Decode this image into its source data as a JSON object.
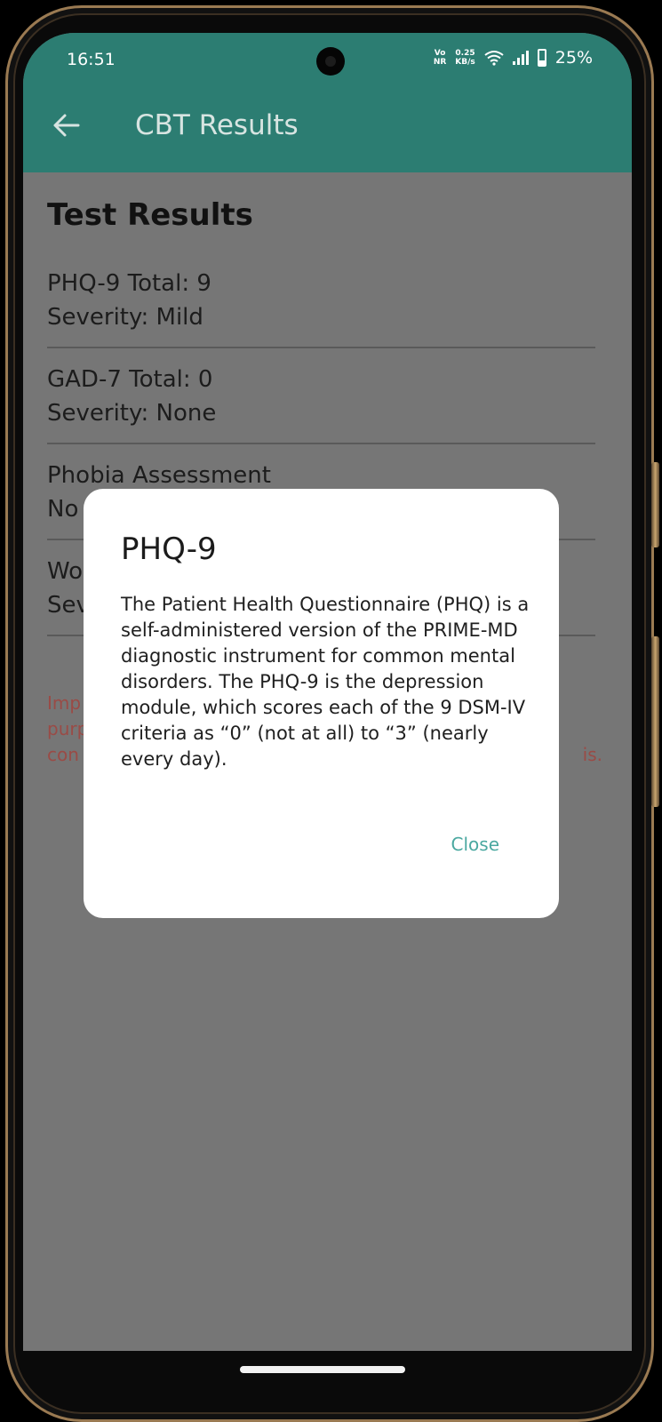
{
  "status_bar": {
    "time": "16:51",
    "network_top": "Vo",
    "network_bottom": "NR",
    "speed_value": "0.25",
    "speed_unit": "KB/s",
    "battery": "25%"
  },
  "app_bar": {
    "title": "CBT Results",
    "back_icon": "arrow-left-icon"
  },
  "results": {
    "heading": "Test Results",
    "items": [
      {
        "line1": "PHQ-9 Total: 9",
        "line2": "Severity: Mild"
      },
      {
        "line1": "GAD-7 Total: 0",
        "line2": "Severity: None"
      },
      {
        "line1": "Phobia Assessment",
        "line2": "No"
      },
      {
        "line1": "Wo",
        "line2": "Sev"
      }
    ],
    "disclaimer_fragments": [
      "Imp",
      "purp",
      "con",
      "is."
    ]
  },
  "dialog": {
    "title": "PHQ-9",
    "body": "The Patient Health Questionnaire (PHQ) is a self-administered version of the PRIME-MD diagnostic instrument for common mental disorders. The PHQ-9 is the depression module, which scores each of the 9 DSM-IV criteria as “0” (not at all) to “3” (nearly every day).",
    "close_label": "Close"
  },
  "colors": {
    "app_bar": "#2c7d72",
    "scrim": "#767676",
    "accent": "#4aa8a0",
    "warning_text": "#9a4b46"
  }
}
